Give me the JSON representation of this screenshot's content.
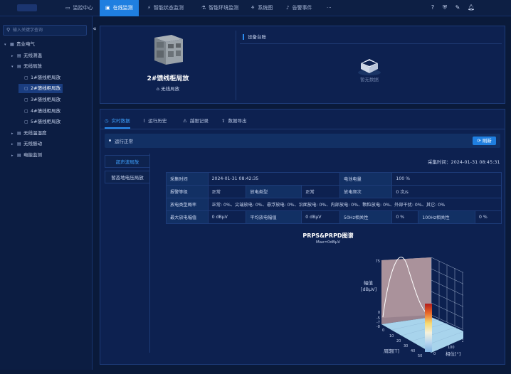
{
  "topbar": {
    "nav": [
      {
        "label": "监控中心",
        "icon": "monitor-icon"
      },
      {
        "label": "在线监测",
        "icon": "screen-icon",
        "active": true
      },
      {
        "label": "智能状态监测",
        "icon": "pulse-icon"
      },
      {
        "label": "智能环境监测",
        "icon": "flask-icon"
      },
      {
        "label": "系统图",
        "icon": "network-icon"
      },
      {
        "label": "告警事件",
        "icon": "bell-icon"
      },
      {
        "label": "···",
        "icon": "more-icon"
      }
    ],
    "right_icons": [
      "help-icon",
      "shield-icon",
      "edit-icon",
      "notification-icon"
    ]
  },
  "sidebar": {
    "search_placeholder": "输入关键字查询",
    "collapse_glyph": "«",
    "tree": [
      {
        "label": "贵业电气",
        "level": 0,
        "expanded": true,
        "icon": "building-icon"
      },
      {
        "label": "无线测温",
        "level": 1,
        "expanded": false,
        "icon": "node-icon"
      },
      {
        "label": "无线局放",
        "level": 1,
        "expanded": true,
        "icon": "node-icon"
      },
      {
        "label": "1#馈线柜局放",
        "level": 2,
        "icon": "device-icon"
      },
      {
        "label": "2#馈线柜局放",
        "level": 2,
        "icon": "device-icon",
        "selected": true
      },
      {
        "label": "3#馈线柜局放",
        "level": 2,
        "icon": "device-icon"
      },
      {
        "label": "4#馈线柜局放",
        "level": 2,
        "icon": "device-icon"
      },
      {
        "label": "5#馈线柜局放",
        "level": 2,
        "icon": "device-icon"
      },
      {
        "label": "无线温湿度",
        "level": 1,
        "expanded": false,
        "icon": "node-icon"
      },
      {
        "label": "无线振动",
        "level": 1,
        "expanded": false,
        "icon": "node-icon"
      },
      {
        "label": "电能监测",
        "level": 1,
        "expanded": false,
        "icon": "node-icon"
      }
    ]
  },
  "device": {
    "name": "2#馈线柜局放",
    "type": "无线局放",
    "ledger_title": "设备台账",
    "no_data": "暂无数据"
  },
  "tabs": [
    {
      "label": "实时数据",
      "icon": "clock-icon",
      "active": true
    },
    {
      "label": "运行历史",
      "icon": "chart-line-icon"
    },
    {
      "label": "越限记录",
      "icon": "alarm-icon"
    },
    {
      "label": "数据导出",
      "icon": "export-icon"
    }
  ],
  "status": {
    "text": "运行正常",
    "refresh_label": "刷新"
  },
  "subtabs": [
    {
      "label": "超声波局放",
      "active": true
    },
    {
      "label": "暂态地电压局放",
      "active": false
    }
  ],
  "collect_time": "采集时间：2024-01-31 08:45:31",
  "info_table": [
    [
      {
        "t": "采集时间",
        "l": true
      },
      {
        "t": "2024-01-31 08:42:35",
        "span": 3
      },
      {
        "t": "电池电量",
        "l": true
      },
      {
        "t": "100 %",
        "span": 3
      }
    ],
    [
      {
        "t": "报警等级",
        "l": true
      },
      {
        "t": "正常"
      },
      {
        "t": "放电类型",
        "l": true
      },
      {
        "t": "正常"
      },
      {
        "t": "放电频次",
        "l": true
      },
      {
        "t": "0 次/s",
        "span": 3
      }
    ],
    [
      {
        "t": "放电类型概率",
        "l": true
      },
      {
        "t": "正常: 0%、尖端放电: 0%、悬浮放电: 0%、沿面放电: 0%、内部放电: 0%、颗粒放电: 0%、外部干扰: 0%、其它: 0%",
        "span": 7
      }
    ],
    [
      {
        "t": "最大放电幅值",
        "l": true
      },
      {
        "t": "0 dBμV"
      },
      {
        "t": "平均放电幅值",
        "l": true
      },
      {
        "t": "0 dBμV"
      },
      {
        "t": "50Hz相关性",
        "l": true
      },
      {
        "t": "0 %"
      },
      {
        "t": "100Hz相关性",
        "l": true
      },
      {
        "t": "0 %"
      }
    ]
  ],
  "chart_data": {
    "type": "surface3d",
    "title": "PRPS&PRPD图谱",
    "subtitle": "Max=0dBμV",
    "zlabel_line1": "幅值",
    "zlabel_line2": "[dBμV]",
    "xlabel": "周期[T]",
    "ylabel": "相位[°]",
    "z_ticks": [
      "75",
      "0",
      "-5",
      "-7",
      "-8"
    ],
    "x_ticks": [
      "0",
      "10",
      "20",
      "30",
      "40",
      "50"
    ],
    "y_ticks": [
      "0",
      "100",
      "200",
      "300"
    ],
    "surface_value": 0
  }
}
